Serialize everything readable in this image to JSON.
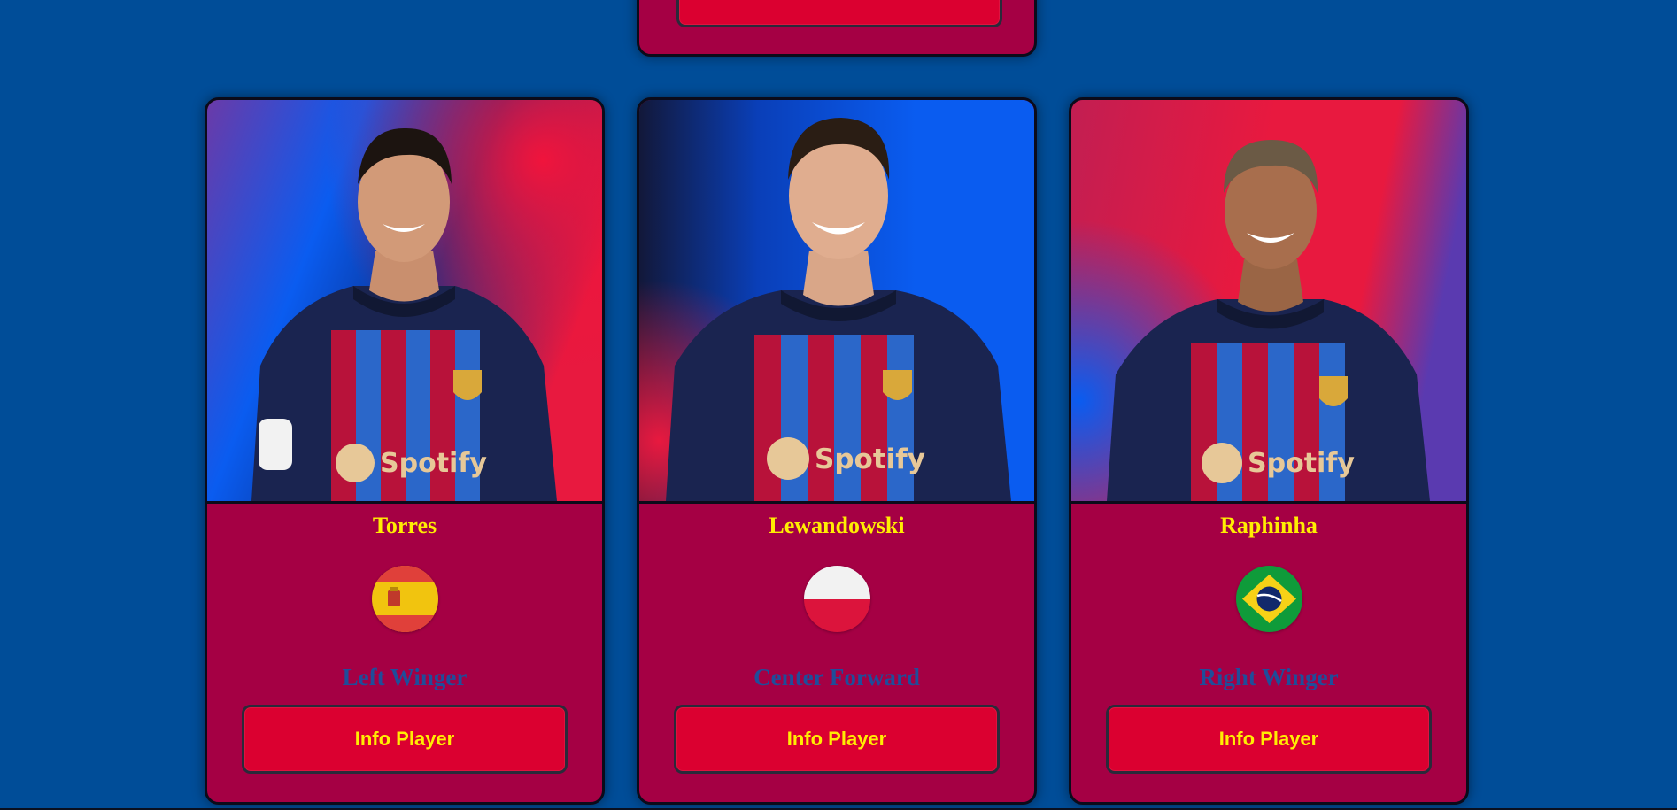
{
  "top_card": {
    "button_label": ""
  },
  "players": [
    {
      "name": "Torres",
      "position": "Left Winger",
      "button_label": "Info Player",
      "flag_icon": "spain-flag-icon",
      "bg_colors": [
        "#0a5cf0",
        "#e8193f"
      ]
    },
    {
      "name": "Lewandowski",
      "position": "Center Forward",
      "button_label": "Info Player",
      "flag_icon": "poland-flag-icon",
      "bg_colors": [
        "#0a5cf0",
        "#141a3a"
      ]
    },
    {
      "name": "Raphinha",
      "position": "Right Winger",
      "button_label": "Info Player",
      "flag_icon": "brazil-flag-icon",
      "bg_colors": [
        "#e8193f",
        "#0a5cf0"
      ]
    }
  ],
  "colors": {
    "page_bg": "#004d98",
    "card_bg": "#a50044",
    "button_bg": "#db0030",
    "name_text": "#ffed02",
    "position_text": "#1f4d9a"
  }
}
